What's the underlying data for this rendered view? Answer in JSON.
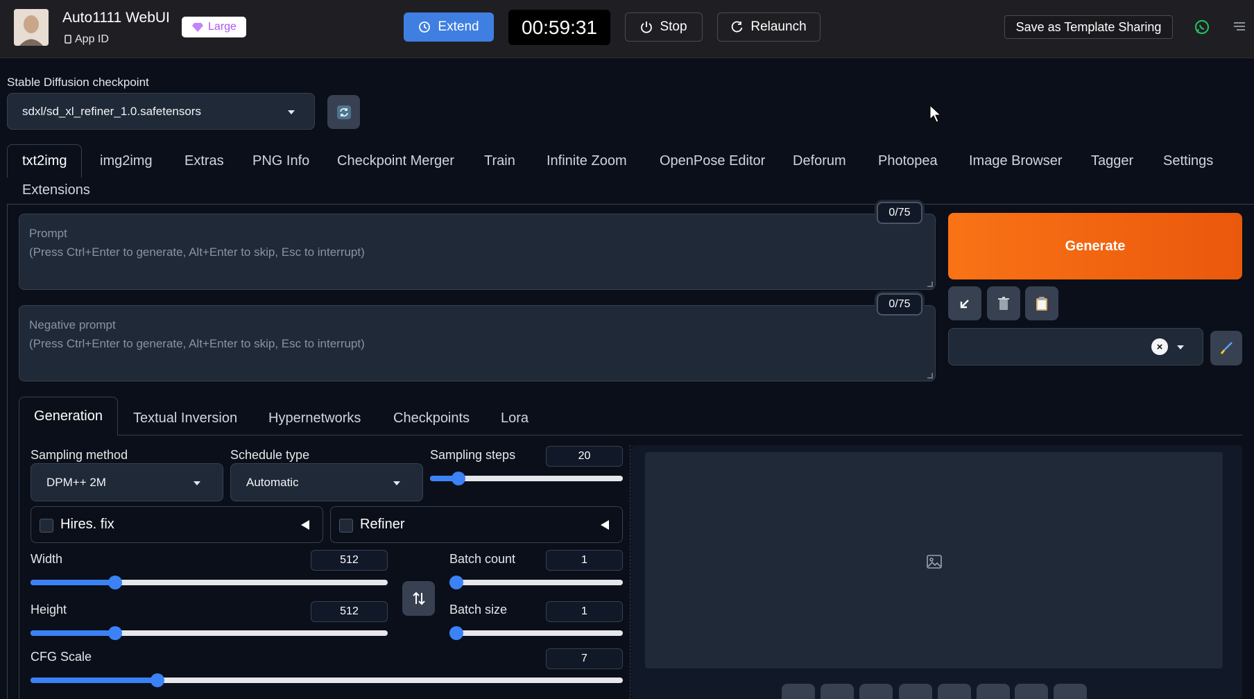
{
  "header": {
    "app_title": "Auto1111 WebUI",
    "app_id_label": "App ID",
    "size_badge": "Large",
    "extend_label": "Extend",
    "timer": "00:59:31",
    "stop_label": "Stop",
    "relaunch_label": "Relaunch",
    "template_label": "Save as Template Sharing"
  },
  "checkpoint": {
    "label": "Stable Diffusion checkpoint",
    "value": "sdxl/sd_xl_refiner_1.0.safetensors"
  },
  "main_tabs": [
    "txt2img",
    "img2img",
    "Extras",
    "PNG Info",
    "Checkpoint Merger",
    "Train",
    "Infinite Zoom",
    "OpenPose Editor",
    "Deforum",
    "Photopea",
    "Image Browser",
    "Tagger",
    "Settings",
    "Extensions"
  ],
  "prompt": {
    "placeholder_title": "Prompt",
    "placeholder_hint": "(Press Ctrl+Enter to generate, Alt+Enter to skip, Esc to interrupt)",
    "counter": "0/75"
  },
  "negative_prompt": {
    "placeholder_title": "Negative prompt",
    "placeholder_hint": "(Press Ctrl+Enter to generate, Alt+Enter to skip, Esc to interrupt)",
    "counter": "0/75"
  },
  "generate_label": "Generate",
  "sub_tabs": [
    "Generation",
    "Textual Inversion",
    "Hypernetworks",
    "Checkpoints",
    "Lora"
  ],
  "generation": {
    "sampling_method_label": "Sampling method",
    "sampling_method_value": "DPM++ 2M",
    "schedule_type_label": "Schedule type",
    "schedule_type_value": "Automatic",
    "sampling_steps_label": "Sampling steps",
    "sampling_steps_value": "20",
    "hires_label": "Hires. fix",
    "refiner_label": "Refiner",
    "width_label": "Width",
    "width_value": "512",
    "height_label": "Height",
    "height_value": "512",
    "batch_count_label": "Batch count",
    "batch_count_value": "1",
    "batch_size_label": "Batch size",
    "batch_size_value": "1",
    "cfg_label": "CFG Scale",
    "cfg_value": "7"
  },
  "colors": {
    "accent": "#3b82f6",
    "generate": "#f97316",
    "extend": "#3f7fe2",
    "background": "#0b0f19"
  }
}
